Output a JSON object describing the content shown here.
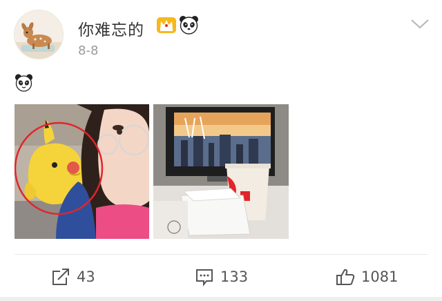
{
  "post": {
    "author": {
      "name": "你难忘的",
      "avatar_icon": "fawn-avatar-icon",
      "badges": [
        "crown-badge-icon",
        "panda-badge-icon"
      ]
    },
    "date": "8-8",
    "text_emoji": "panda-emoji-icon",
    "photos": [
      {
        "icon": "selfie-photo-with-pikachu-plush"
      },
      {
        "icon": "desk-photo-tv-cup-takeout-box"
      }
    ],
    "highlight_color": "#e1252a"
  },
  "actions": {
    "repost_count": "43",
    "comment_count": "133",
    "like_count": "1081"
  }
}
